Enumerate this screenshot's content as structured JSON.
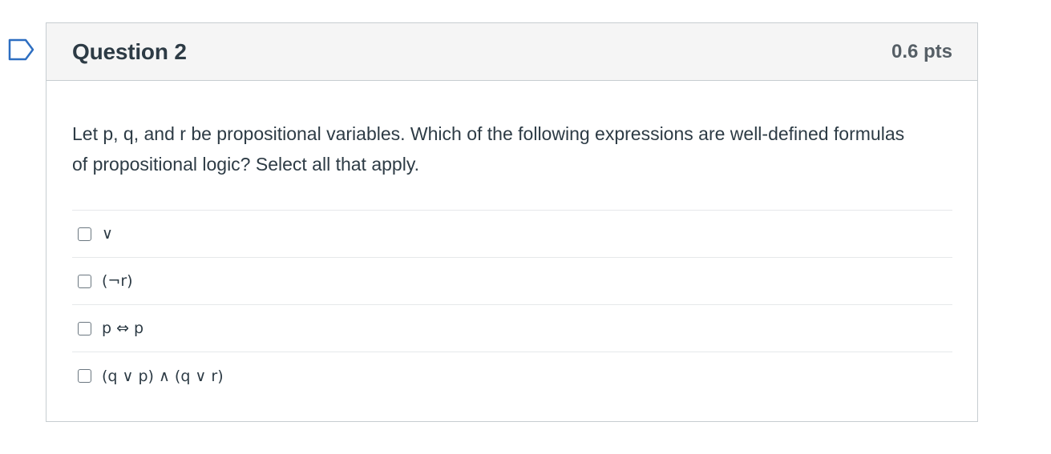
{
  "flag": {
    "icon": "bookmark-flag-icon",
    "color": "#2d6ec1"
  },
  "question": {
    "title": "Question 2",
    "points": "0.6 pts",
    "text": "Let p, q, and r be propositional variables. Which of the following expressions are well-defined formulas of propositional logic? Select all that apply.",
    "answers": [
      {
        "label": "∨",
        "checked": false
      },
      {
        "label": "(¬r)",
        "checked": false
      },
      {
        "label": "p ⇔ p",
        "checked": false
      },
      {
        "label": "(q ∨ p) ∧ (q ∨ r)",
        "checked": false
      }
    ]
  }
}
